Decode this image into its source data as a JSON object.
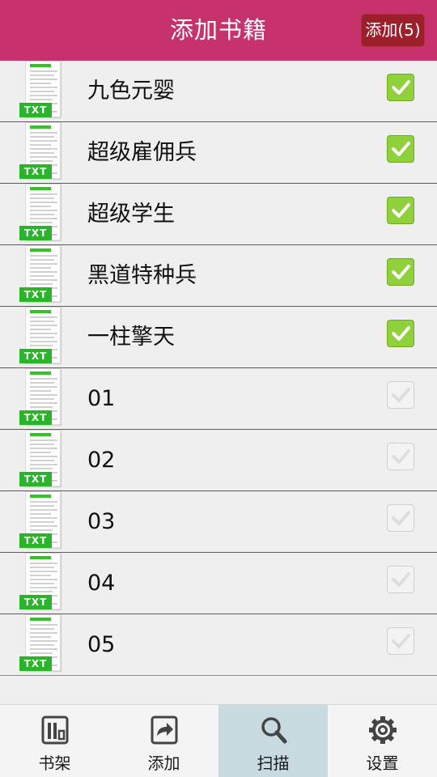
{
  "header": {
    "title": "添加书籍",
    "add_button": "添加(5)"
  },
  "file_tag": "TXT",
  "books": [
    {
      "name": "九色元婴",
      "checked": true
    },
    {
      "name": "超级雇佣兵",
      "checked": true
    },
    {
      "name": "超级学生",
      "checked": true
    },
    {
      "name": "黑道特种兵",
      "checked": true
    },
    {
      "name": "一柱擎天",
      "checked": true
    },
    {
      "name": "01",
      "checked": false
    },
    {
      "name": "02",
      "checked": false
    },
    {
      "name": "03",
      "checked": false
    },
    {
      "name": "04",
      "checked": false
    },
    {
      "name": "05",
      "checked": false
    }
  ],
  "tabs": [
    {
      "label": "书架",
      "icon": "bookshelf-icon",
      "active": false
    },
    {
      "label": "添加",
      "icon": "import-icon",
      "active": false
    },
    {
      "label": "扫描",
      "icon": "search-icon",
      "active": true
    },
    {
      "label": "设置",
      "icon": "gear-icon",
      "active": false
    }
  ],
  "colors": {
    "header_bg": "#c8326c",
    "add_button_bg": "#9e1f2c",
    "checkbox_checked": "#8fd13b",
    "txt_tag": "#2bb32b",
    "active_tab_bg": "#c6dae0"
  }
}
